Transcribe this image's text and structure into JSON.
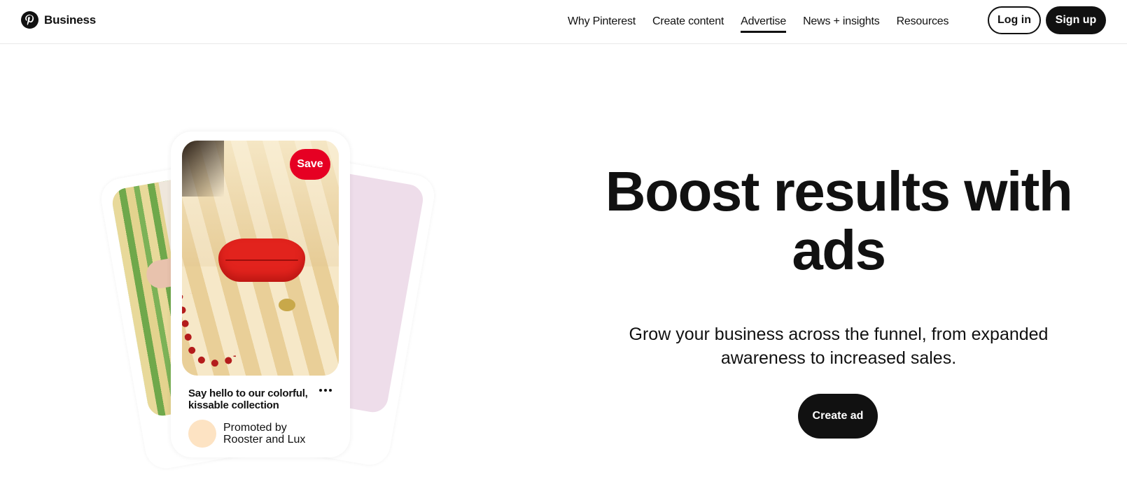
{
  "header": {
    "brand": {
      "icon": "pinterest-logo-icon",
      "label": "Business"
    },
    "nav": [
      {
        "label": "Why Pinterest",
        "active": false
      },
      {
        "label": "Create content",
        "active": false
      },
      {
        "label": "Advertise",
        "active": true
      },
      {
        "label": "News + insights",
        "active": false
      },
      {
        "label": "Resources",
        "active": false
      }
    ],
    "login_label": "Log in",
    "signup_label": "Sign up"
  },
  "pin_preview": {
    "save_label": "Save",
    "title": "Say hello to our colorful, kissable collection",
    "more_icon": "ellipsis-icon",
    "promoted_label": "Promoted by",
    "advertiser": "Rooster and Lux",
    "colors": {
      "save": "#e60023",
      "avatar": "#fde3c3"
    }
  },
  "hero": {
    "title": "Boost results with ads",
    "subtitle": "Grow your business across the funnel, from expanded awareness to increased sales.",
    "cta_label": "Create ad"
  }
}
